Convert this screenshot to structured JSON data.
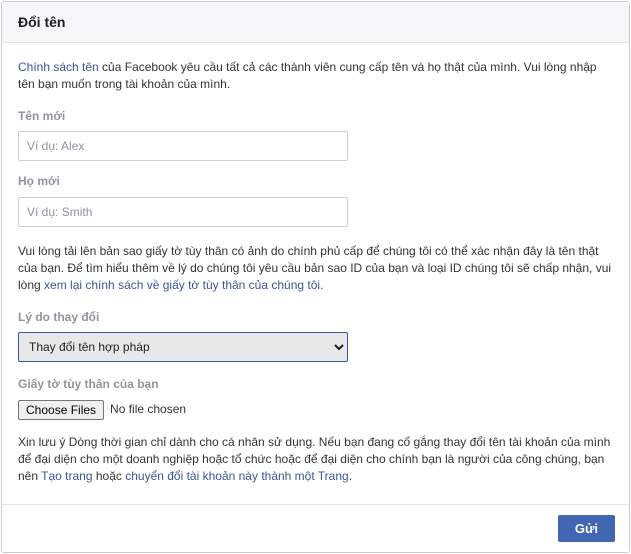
{
  "header": {
    "title": "Đổi tên"
  },
  "body": {
    "intro_link": "Chính sách tên",
    "intro_rest": " của Facebook yêu cầu tất cả các thành viên cung cấp tên và họ thật của mình. Vui lòng nhập tên bạn muốn trong tài khoản của mình.",
    "first_name_label": "Tên mới",
    "first_name_placeholder": "Ví dụ: Alex",
    "last_name_label": "Họ mới",
    "last_name_placeholder": "Ví dụ: Smith",
    "upload_para_pre": "Vui lòng tải lên bản sao giấy tờ tùy thân có ảnh do chính phủ cấp để chúng tôi có thể xác nhận đây là tên thật của bạn. Để tìm hiểu thêm về lý do chúng tôi yêu cầu bản sao ID của bạn và loại ID chúng tôi sẽ chấp nhận, vui lòng ",
    "upload_para_link": "xem lại chính sách về giấy tờ tùy thân của chúng tôi",
    "upload_para_post": ".",
    "reason_label": "Lý do thay đổi",
    "reason_selected": "Thay đổi tên hợp pháp",
    "id_label": "Giấy tờ tùy thân của bạn",
    "file_button": "Choose Files",
    "file_status": "No file chosen",
    "note_pre": "Xin lưu ý Dòng thời gian chỉ dành cho cá nhân sử dụng. Nếu bạn đang cố gắng thay đổi tên tài khoản của mình để đại diện cho một doanh nghiệp hoặc tổ chức hoặc để đại diện cho chính bạn là người của công chúng, bạn nên ",
    "note_link1": "Tạo trang",
    "note_mid": " hoặc ",
    "note_link2": "chuyển đổi tài khoản này thành một Trang",
    "note_post": "."
  },
  "footer": {
    "submit": "Gửi"
  }
}
